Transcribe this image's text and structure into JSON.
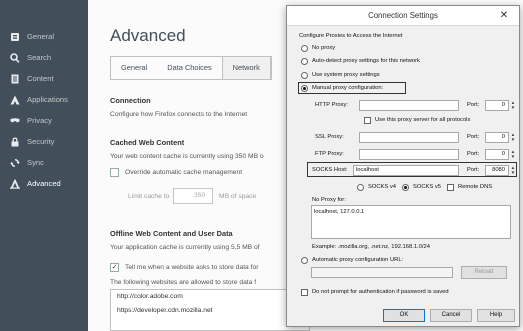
{
  "sidebar": {
    "items": [
      {
        "label": "General",
        "icon": "general-icon",
        "active": false
      },
      {
        "label": "Search",
        "icon": "search-icon",
        "active": false
      },
      {
        "label": "Content",
        "icon": "content-icon",
        "active": false
      },
      {
        "label": "Applications",
        "icon": "applications-icon",
        "active": false
      },
      {
        "label": "Privacy",
        "icon": "privacy-icon",
        "active": false
      },
      {
        "label": "Security",
        "icon": "security-icon",
        "active": false
      },
      {
        "label": "Sync",
        "icon": "sync-icon",
        "active": false
      },
      {
        "label": "Advanced",
        "icon": "advanced-icon",
        "active": true
      }
    ]
  },
  "main": {
    "title": "Advanced",
    "tabs": [
      {
        "label": "General",
        "selected": false
      },
      {
        "label": "Data Choices",
        "selected": false
      },
      {
        "label": "Network",
        "selected": true
      }
    ],
    "connection": {
      "heading": "Connection",
      "desc": "Configure how Firefox connects to the Internet"
    },
    "cache": {
      "heading": "Cached Web Content",
      "desc": "Your web content cache is currently using 350 MB o",
      "override_label": "Override automatic cache management",
      "limit_label": "Limit cache to",
      "limit_value": "350",
      "limit_unit": "MB of space"
    },
    "offline": {
      "heading": "Offline Web Content and User Data",
      "desc": "Your application cache is currently using 5,5 MB of",
      "tell_label": "Tell me when a website asks to store data for",
      "allowed_desc": "The following websites are allowed to store data f",
      "sites": [
        "http://color.adobe.com",
        "https://developer.cdn.mozilla.net"
      ]
    }
  },
  "dialog": {
    "title": "Connection Settings",
    "close": "✕",
    "group_label": "Configure Proxies to Access the Internet",
    "options": {
      "no_proxy": "No proxy",
      "auto_detect": "Auto-detect proxy settings for this network",
      "system": "Use system proxy settings",
      "manual": "Manual proxy configuration:"
    },
    "http_label": "HTTP Proxy:",
    "same_proxy": "Use this proxy server for all protocols",
    "ssl_label": "SSL Proxy:",
    "ftp_label": "FTP Proxy:",
    "socks_label": "SOCKS Host:",
    "socks_value": "localhost",
    "port_label": "Port:",
    "http_port": "0",
    "ssl_port": "0",
    "ftp_port": "0",
    "socks_port": "8080",
    "socks_v4": "SOCKS v4",
    "socks_v5": "SOCKS v5",
    "remote_dns": "Remote DNS",
    "no_proxy_for": "No Proxy for:",
    "no_proxy_value": "localhost, 127.0.0.1",
    "example": "Example: .mozilla.org, .net.nz, 192.168.1.0/24",
    "auto_url": "Automatic proxy configuration URL:",
    "reload": "Reload",
    "no_prompt": "Do not prompt for authentication if password is saved",
    "ok": "OK",
    "cancel": "Cancel",
    "help": "Help"
  }
}
